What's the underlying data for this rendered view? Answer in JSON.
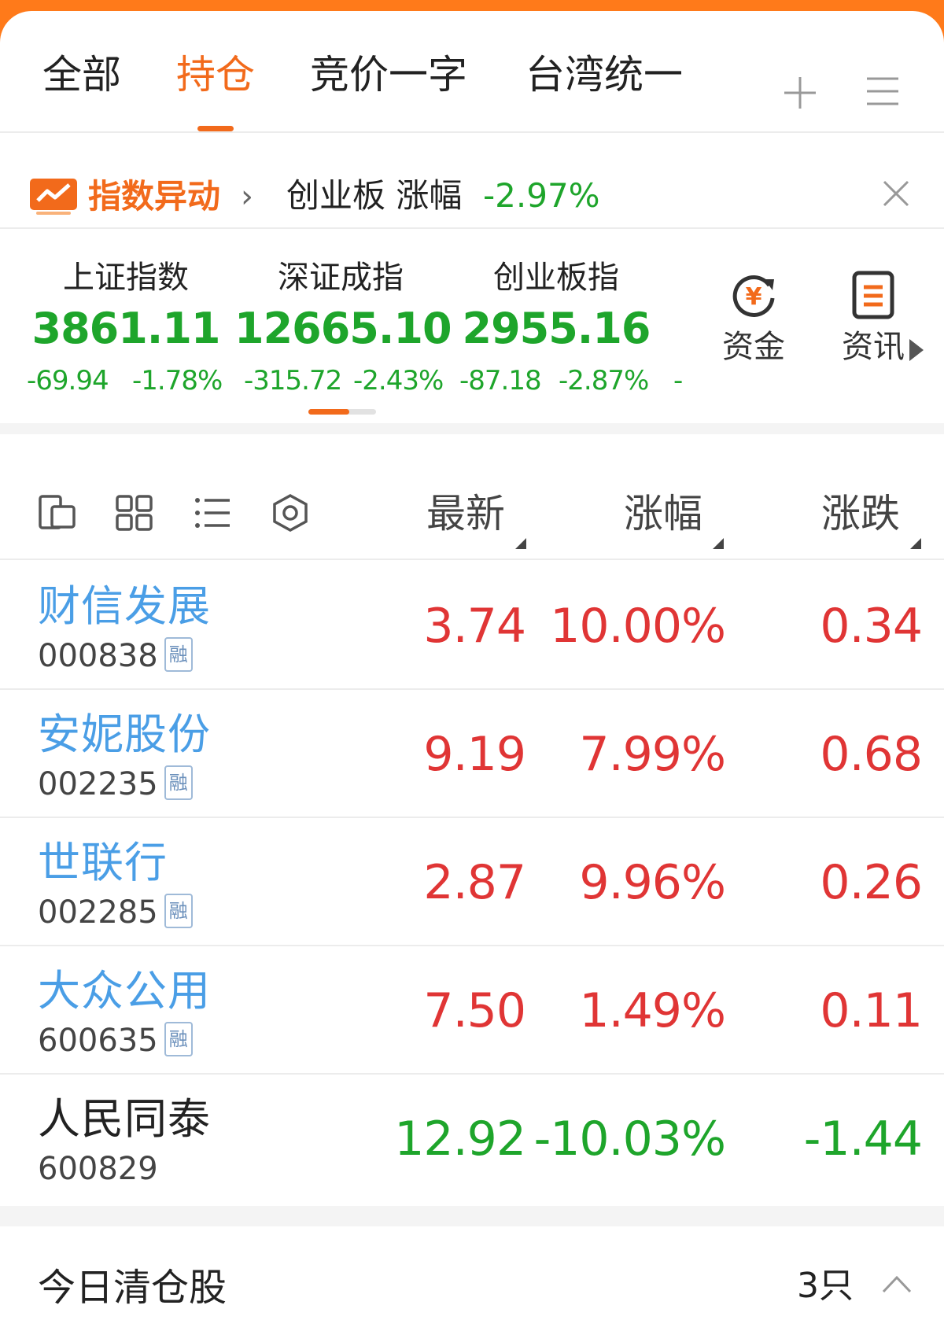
{
  "tabs": [
    {
      "label": "全部",
      "active": false
    },
    {
      "label": "持仓",
      "active": true
    },
    {
      "label": "竞价一字",
      "active": false
    },
    {
      "label": "台湾统一",
      "active": false
    }
  ],
  "alert": {
    "brand": "指数异动",
    "text": "创业板 涨幅",
    "change": "-2.97%"
  },
  "indices": [
    {
      "name": "上证指数",
      "value": "3861.11",
      "change": "-69.94",
      "pct": "-1.78%"
    },
    {
      "name": "深证成指",
      "value": "12665.10",
      "change": "-315.72",
      "pct": "-2.43%"
    },
    {
      "name": "创业板指",
      "value": "2955.16",
      "change": "-87.18",
      "pct": "-2.87%"
    }
  ],
  "indices_more": "-",
  "tools": [
    {
      "label": "资金",
      "icon": "yuan-cycle-icon"
    },
    {
      "label": "资讯",
      "icon": "news-doc-icon"
    }
  ],
  "columns": {
    "last": "最新",
    "pct": "涨幅",
    "chg": "涨跌"
  },
  "stocks": [
    {
      "name": "财信发展",
      "code": "000838",
      "margin": "融",
      "last": "3.74",
      "pct": "10.00%",
      "chg": "0.34",
      "trend": "up"
    },
    {
      "name": "安妮股份",
      "code": "002235",
      "margin": "融",
      "last": "9.19",
      "pct": "7.99%",
      "chg": "0.68",
      "trend": "up"
    },
    {
      "name": "世联行",
      "code": "002285",
      "margin": "融",
      "last": "2.87",
      "pct": "9.96%",
      "chg": "0.26",
      "trend": "up"
    },
    {
      "name": "大众公用",
      "code": "600635",
      "margin": "融",
      "last": "7.50",
      "pct": "1.49%",
      "chg": "0.11",
      "trend": "up"
    },
    {
      "name": "人民同泰",
      "code": "600829",
      "margin": "",
      "last": "12.92",
      "pct": "-10.03%",
      "chg": "-1.44",
      "trend": "down"
    }
  ],
  "cleared": {
    "label": "今日清仓股",
    "count": "3只"
  },
  "colors": {
    "accent": "#f26a1b",
    "up": "#e03535",
    "down": "#1ea52b",
    "link": "#4a9ee6"
  }
}
